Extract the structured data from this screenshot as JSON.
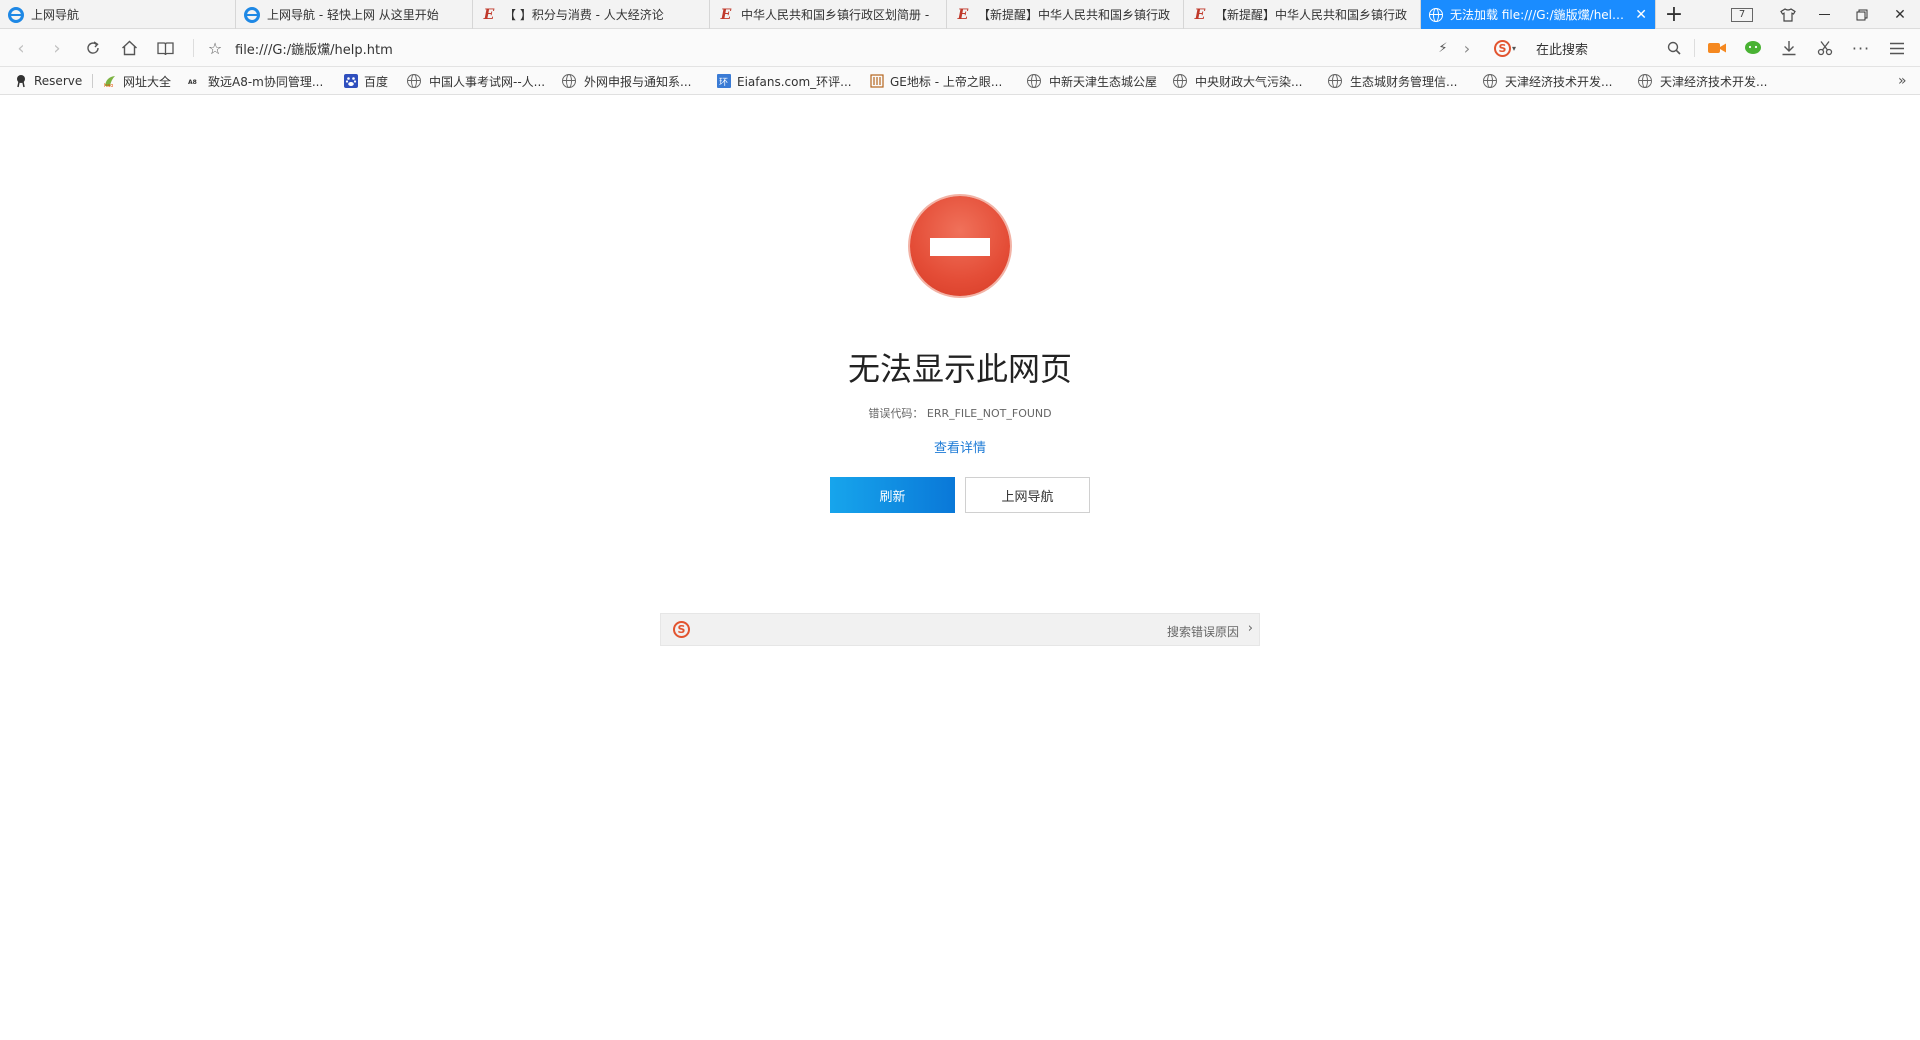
{
  "tabs": [
    {
      "label": "上网导航",
      "icon": "ie-icon",
      "active": false
    },
    {
      "label": "上网导航 - 轻快上网 从这里开始",
      "icon": "ie-icon",
      "active": false
    },
    {
      "label": "【 】积分与消费 - 人大经济论",
      "icon": "e-icon",
      "active": false
    },
    {
      "label": "中华人民共和国乡镇行政区划简册 -",
      "icon": "e-icon",
      "active": false
    },
    {
      "label": "【新提醒】中华人民共和国乡镇行政",
      "icon": "e-icon",
      "active": false
    },
    {
      "label": "【新提醒】中华人民共和国乡镇行政",
      "icon": "e-icon",
      "active": false
    },
    {
      "label": "无法加载 file:///G:/鍦版爣/help.ht",
      "icon": "globe-icon",
      "active": true
    }
  ],
  "tab_count": "7",
  "address": "file:///G:/鍦版爣/help.htm",
  "search_placeholder": "在此搜索",
  "bookmarks": [
    {
      "label": "Reserve",
      "icon": "reserve-icon"
    },
    {
      "label": "网址大全",
      "icon": "hao-icon"
    },
    {
      "label": "致远A8-m协同管理...",
      "icon": "seeyon-icon"
    },
    {
      "label": "百度",
      "icon": "baidu-icon"
    },
    {
      "label": "中国人事考试网--人...",
      "icon": "globe-icon"
    },
    {
      "label": "外网申报与通知系...",
      "icon": "globe-icon"
    },
    {
      "label": "Eiafans.com_环评...",
      "icon": "eiafans-icon"
    },
    {
      "label": "GE地标 - 上帝之眼...",
      "icon": "ge-icon"
    },
    {
      "label": "中新天津生态城公屋",
      "icon": "globe-icon"
    },
    {
      "label": "中央财政大气污染...",
      "icon": "globe-icon"
    },
    {
      "label": "生态城财务管理信...",
      "icon": "globe-icon"
    },
    {
      "label": "天津经济技术开发...",
      "icon": "globe-icon"
    },
    {
      "label": "天津经济技术开发...",
      "icon": "globe-icon"
    }
  ],
  "error": {
    "title": "无法显示此网页",
    "code_line": "错误代码： ERR_FILE_NOT_FOUND",
    "details_link": "查看详情",
    "refresh_label": "刷新",
    "nav_label": "上网导航",
    "search_reason": "搜索错误原因"
  },
  "colors": {
    "active_tab": "#1a8cff",
    "error_red": "#e44d37",
    "primary_button": "#0a78d8",
    "link": "#1e7bd6"
  }
}
